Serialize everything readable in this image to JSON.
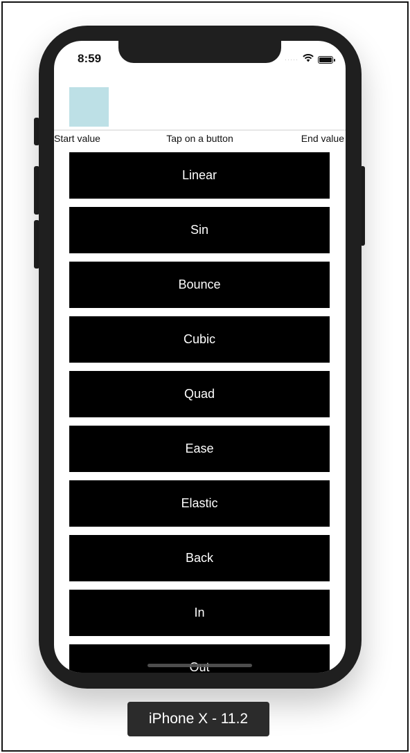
{
  "status_bar": {
    "time": "8:59",
    "signal": "·····"
  },
  "animation": {
    "box_color": "#bde0e6"
  },
  "labels": {
    "start": "Start value",
    "middle": "Tap on a button",
    "end": "End value"
  },
  "buttons": [
    {
      "label": "Linear"
    },
    {
      "label": "Sin"
    },
    {
      "label": "Bounce"
    },
    {
      "label": "Cubic"
    },
    {
      "label": "Quad"
    },
    {
      "label": "Ease"
    },
    {
      "label": "Elastic"
    },
    {
      "label": "Back"
    },
    {
      "label": "In"
    },
    {
      "label": "Out"
    }
  ],
  "device": {
    "name": "iPhone X - 11.2"
  }
}
